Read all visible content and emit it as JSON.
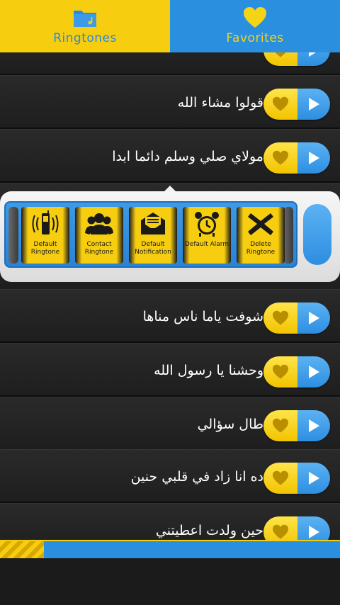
{
  "tabs": {
    "ringtones": {
      "label": "Ringtones",
      "icon": "folder-music-icon"
    },
    "favorites": {
      "label": "Favorites",
      "icon": "heart-icon"
    }
  },
  "list": {
    "items": [
      {
        "title": "قولوا مشاء الله"
      },
      {
        "title": "مولاي صلي وسلم دائما ابدا"
      },
      {
        "title": ""
      },
      {
        "title": ""
      },
      {
        "title": "شوفت ياما ناس مناها"
      },
      {
        "title": "وحشنا يا رسول الله"
      },
      {
        "title": "طال سؤالي"
      },
      {
        "title": "ده انا زاد في قلبي حنين"
      },
      {
        "title": "حين ولدت اعطيتني"
      }
    ]
  },
  "popup": {
    "actions": [
      {
        "label": "Default Ringtone",
        "icon": "phone-ringing-icon"
      },
      {
        "label": "Contact Ringtone",
        "icon": "contacts-icon"
      },
      {
        "label": "Default Notification",
        "icon": "envelope-icon"
      },
      {
        "label": "Default Alarm",
        "icon": "alarm-clock-icon"
      },
      {
        "label": "Delete Ringtone",
        "icon": "delete-x-icon"
      }
    ]
  },
  "progress": {
    "fraction": 0.13
  },
  "colors": {
    "yellow": "#f7cd10",
    "blue": "#2b8fe0",
    "background": "#1b1b1b"
  }
}
